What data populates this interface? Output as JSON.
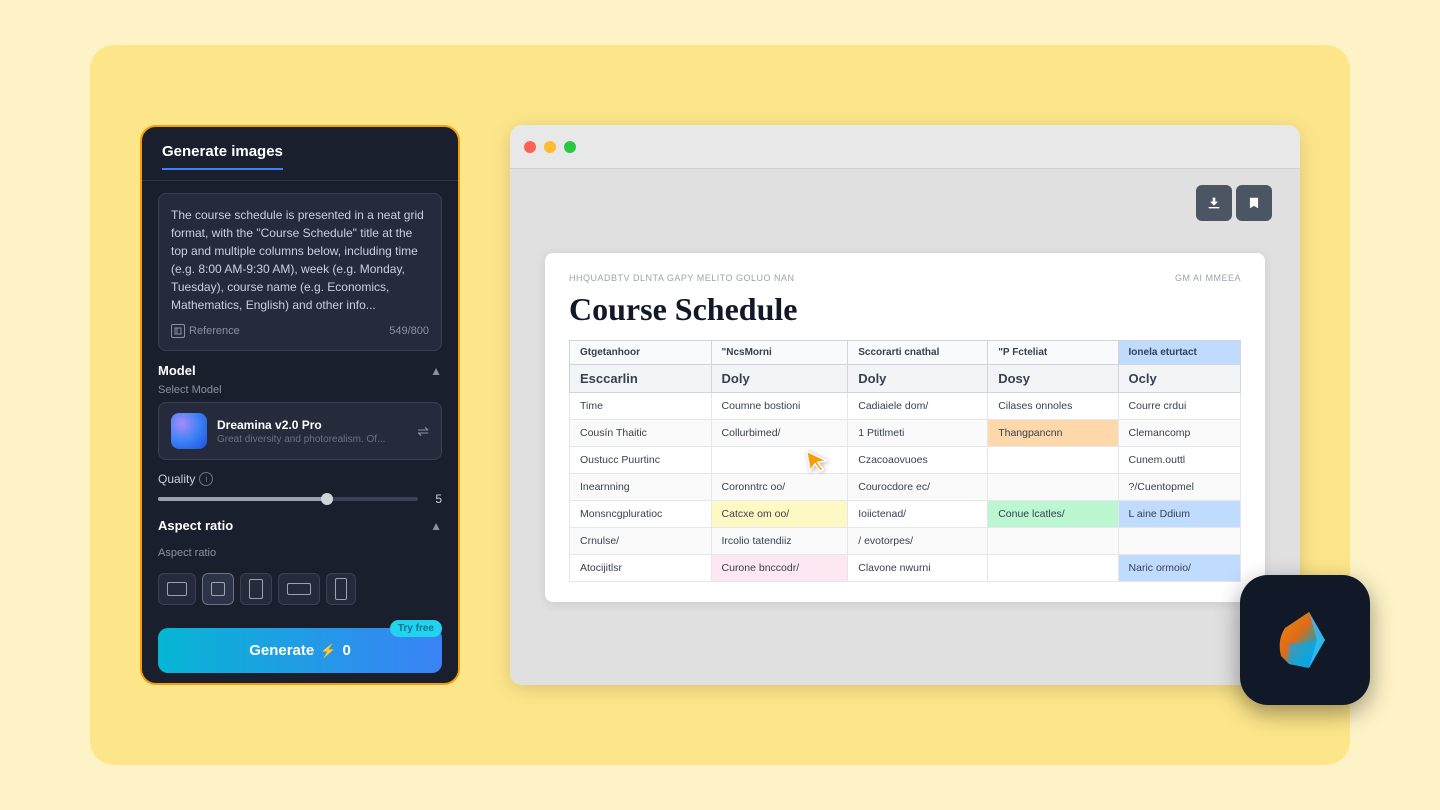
{
  "background_color": "#fde68a",
  "left_panel": {
    "title": "Generate images",
    "prompt_text": "The course schedule is presented in a neat grid format, with the \"Course Schedule\" title at the top and multiple columns below, including time (e.g. 8:00 AM-9:30 AM), week (e.g. Monday, Tuesday), course name (e.g. Economics, Mathematics, English) and other info...",
    "reference_label": "Reference",
    "char_count": "549/800",
    "model_section": "Model",
    "select_model_label": "Select Model",
    "model_name": "Dreamina v2.0 Pro",
    "model_desc": "Great diversity and photorealism. Of...",
    "quality_label": "Quality",
    "quality_value": "5",
    "aspect_ratio_label": "Aspect ratio",
    "aspect_ratio_sub": "Aspect ratio",
    "try_free_label": "Try free",
    "generate_label": "Generate",
    "generate_credits": "0"
  },
  "browser": {
    "toolbar_download": "⬇",
    "toolbar_bookmark": "🔖",
    "schedule": {
      "meta_left": "HHQUADBTV    DLNTA    GAPY    MELITO    GOLUO    NAN",
      "meta_right": "GM AI MMEEA",
      "title": "Course Schedule",
      "header_col1": "Gtgetanhoor",
      "header_col2": "\"NcsMorni",
      "header_col3": "Sccorarti cnathal",
      "header_col4": "\"P Fcteliat",
      "header_col5": "Ionela eturtact",
      "subheader_col1": "Esccarlin",
      "subheader_col2": "Doly",
      "subheader_col3": "Doly",
      "subheader_col4": "Dosy",
      "subheader_col5": "Ocly",
      "rows": [
        {
          "col1": "Time",
          "col2": "Coumne bostioni",
          "col3": "Cadiaiele dom/",
          "col4": "Cilases onnoles",
          "col5": "Courre crdui",
          "col2_style": "",
          "col3_style": "",
          "col4_style": "",
          "col5_style": ""
        },
        {
          "col1": "Cousín Thaitic",
          "col2": "Collurbimed/",
          "col3": "1 Ptitlmeti",
          "col4": "Thangpancnn",
          "col5": "Clemancomp",
          "col2_style": "",
          "col3_style": "",
          "col4_style": "orange",
          "col5_style": ""
        },
        {
          "col1": "Oustucc Puurtinc",
          "col2": "",
          "col3": "Czacoaovuoes",
          "col4": "",
          "col5": "Cunem.outtl",
          "col2_style": "",
          "col3_style": "",
          "col4_style": "",
          "col5_style": ""
        },
        {
          "col1": "Inearnning",
          "col2": "Coronntrc oo/",
          "col3": "Courocdore ec/",
          "col4": "",
          "col5": "?/Cuentopmel",
          "col2_style": "",
          "col3_style": "",
          "col4_style": "",
          "col5_style": ""
        },
        {
          "col1": "Monsncgpluratioc",
          "col2": "Catcxe om oo/",
          "col3": "Ioiictenad/",
          "col4": "Conue lcatles/",
          "col5": "L aine Ddium",
          "col2_style": "yellow",
          "col3_style": "",
          "col4_style": "green",
          "col5_style": "blue"
        },
        {
          "col1": "Crnulse/",
          "col2": "Ircolio tatendiiz",
          "col3": "/ evotorpes/",
          "col4": "",
          "col5": "",
          "col2_style": "",
          "col3_style": "",
          "col4_style": "",
          "col5_style": ""
        },
        {
          "col1": "Atocijitlsr",
          "col2": "Curone bnccodr/",
          "col3": "Clavone nwurni",
          "col4": "",
          "col5": "Naric ormoio/",
          "col2_style": "pink",
          "col3_style": "",
          "col4_style": "",
          "col5_style": "blue"
        }
      ]
    }
  }
}
